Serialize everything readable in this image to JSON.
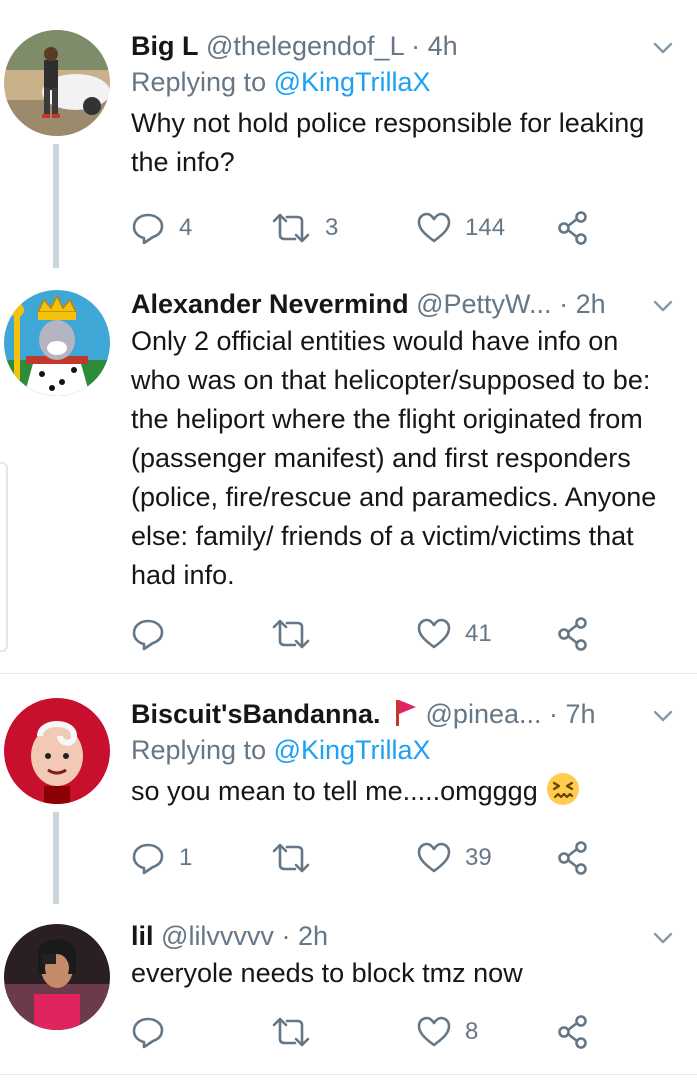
{
  "tweets": [
    {
      "name": "Big L",
      "handle": "@thelegendof_L",
      "time": "· 4h",
      "replying_prefix": "Replying to ",
      "replying_to": "@KingTrillaX",
      "text": "Why not hold police responsible for leaking the info?",
      "replies": "4",
      "retweets": "3",
      "likes": "144"
    },
    {
      "name": "Alexander Nevermind",
      "handle": "@PettyW...",
      "time": "· 2h",
      "text": "Only 2 official entities would have info on who was on that helicopter/supposed to be: the heliport where the flight originated from (passenger manifest) and first responders (police, fire/rescue and paramedics. Anyone else: family/ friends of a victim/victims that had info.",
      "replies": "",
      "retweets": "",
      "likes": "41"
    },
    {
      "name": "Biscuit'sBandanna.",
      "handle": "@pinea...",
      "time": "· 7h",
      "replying_prefix": "Replying to ",
      "replying_to": "@KingTrillaX",
      "text": "so you mean to tell me.....omgggg",
      "replies": "1",
      "retweets": "",
      "likes": "39"
    },
    {
      "name": "lil",
      "handle": "@lilvvvvv",
      "time": "· 2h",
      "text": "everyole needs to block tmz now",
      "replies": "",
      "retweets": "",
      "likes": "8"
    }
  ],
  "icons": {
    "reply": "reply-icon",
    "retweet": "retweet-icon",
    "like": "heart-icon",
    "share": "share-icon",
    "more": "chevron-down-icon",
    "flag": "red-flag-icon",
    "emoji": "confounded-face-emoji"
  },
  "colors": {
    "text": "#14171a",
    "secondary": "#657786",
    "link": "#1da1f2",
    "thread_line": "#ccd6dd",
    "divider": "#e1e8ed"
  }
}
